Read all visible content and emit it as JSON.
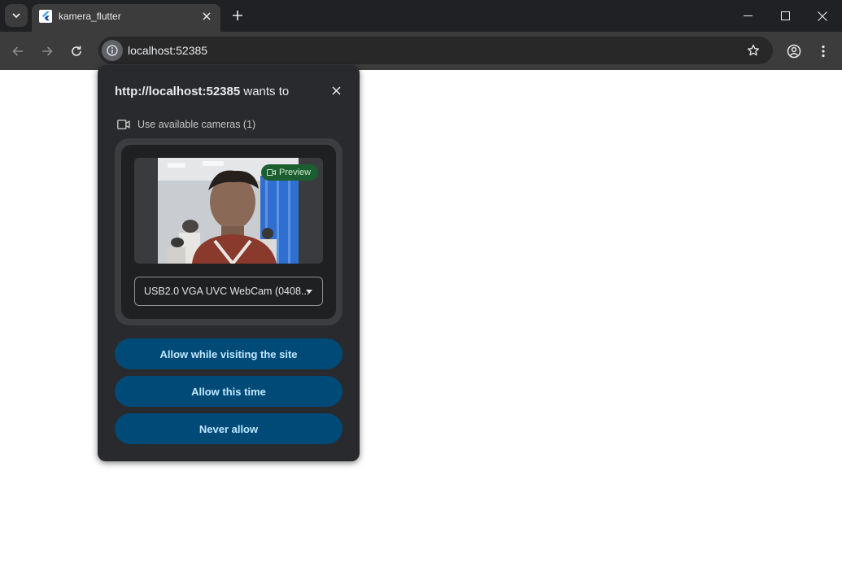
{
  "tab": {
    "title": "kamera_flutter"
  },
  "toolbar": {
    "url": "localhost:52385"
  },
  "popup": {
    "origin": "http://localhost:52385",
    "wants_to": "wants to",
    "permission_label": "Use available cameras (1)",
    "preview_label": "Preview",
    "camera_select_value": "USB2.0 VGA UVC WebCam (0408...",
    "buttons": {
      "allow_while_visiting": "Allow while visiting the site",
      "allow_this_time": "Allow this time",
      "never_allow": "Never allow"
    }
  },
  "colors": {
    "tabstrip_bg": "#202124",
    "toolbar_bg": "#3c3c3c",
    "popup_bg": "#292a2d",
    "button_bg": "#004a77",
    "button_text": "#c2e7ff",
    "preview_badge_bg": "#1b5e2f"
  },
  "icons": [
    "tab-search-icon",
    "flutter-favicon-icon",
    "tab-close-icon",
    "new-tab-icon",
    "minimize-icon",
    "maximize-icon",
    "window-close-icon",
    "back-icon",
    "forward-icon",
    "reload-icon",
    "site-info-icon",
    "bookmark-star-icon",
    "profile-icon",
    "menu-icon",
    "popup-close-icon",
    "camera-icon",
    "preview-camera-icon",
    "dropdown-arrow-icon"
  ]
}
